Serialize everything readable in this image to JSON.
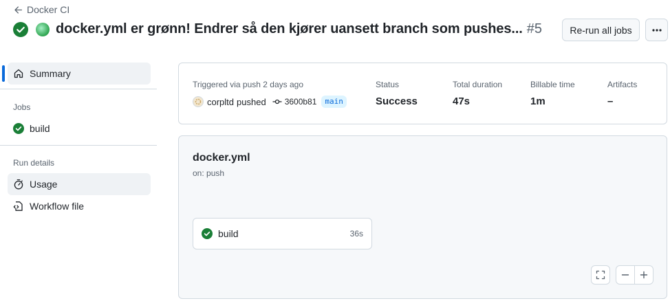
{
  "header": {
    "back_label": "Docker CI",
    "title": "docker.yml er grønn! Endrer så den kjører uansett branch som pushes...",
    "run_number": "#5",
    "rerun_label": "Re-run all jobs"
  },
  "sidebar": {
    "summary_label": "Summary",
    "jobs_heading": "Jobs",
    "job_label": "build",
    "run_details_heading": "Run details",
    "usage_label": "Usage",
    "workflow_file_label": "Workflow file"
  },
  "summary": {
    "triggered_label": "Triggered via push 2 days ago",
    "actor": "corpltd",
    "pushed_text": "pushed",
    "commit": "3600b81",
    "branch": "main",
    "status_label": "Status",
    "status_value": "Success",
    "duration_label": "Total duration",
    "duration_value": "47s",
    "billable_label": "Billable time",
    "billable_value": "1m",
    "artifacts_label": "Artifacts",
    "artifacts_value": "–"
  },
  "graph": {
    "workflow_name": "docker.yml",
    "trigger": "on: push",
    "job_name": "build",
    "job_duration": "36s"
  },
  "colors": {
    "success": "#1a7f37",
    "accent": "#0969da",
    "muted": "#59636e"
  }
}
